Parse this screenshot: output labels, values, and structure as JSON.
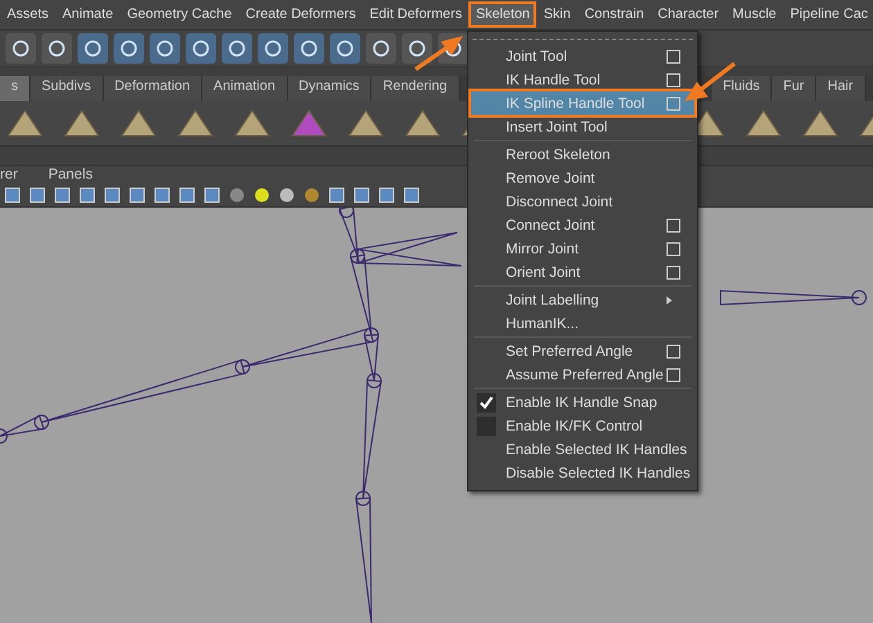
{
  "menubar": [
    {
      "label": "Assets",
      "selected": false
    },
    {
      "label": "Animate",
      "selected": false
    },
    {
      "label": "Geometry Cache",
      "selected": false
    },
    {
      "label": "Create Deformers",
      "selected": false
    },
    {
      "label": "Edit Deformers",
      "selected": false
    },
    {
      "label": "Skeleton",
      "selected": true
    },
    {
      "label": "Skin",
      "selected": false
    },
    {
      "label": "Constrain",
      "selected": false
    },
    {
      "label": "Character",
      "selected": false
    },
    {
      "label": "Muscle",
      "selected": false
    },
    {
      "label": "Pipeline Cac",
      "selected": false
    }
  ],
  "shelf_tabs": [
    {
      "label": "s",
      "selected": true
    },
    {
      "label": "Subdivs",
      "selected": false
    },
    {
      "label": "Deformation",
      "selected": false
    },
    {
      "label": "Animation",
      "selected": false
    },
    {
      "label": "Dynamics",
      "selected": false
    },
    {
      "label": "Rendering",
      "selected": false
    },
    {
      "label": "Fluids",
      "selected": false
    },
    {
      "label": "Fur",
      "selected": false
    },
    {
      "label": "Hair",
      "selected": false
    }
  ],
  "panel_menu": [
    "rer",
    "Panels"
  ],
  "skeleton_menu": {
    "sections": [
      [
        {
          "kind": "tool",
          "label": "Joint Tool",
          "option_box": true,
          "selected": false
        },
        {
          "kind": "tool",
          "label": "IK Handle Tool",
          "option_box": true,
          "selected": false
        },
        {
          "kind": "tool",
          "label": "IK Spline Handle Tool",
          "option_box": true,
          "selected": true
        },
        {
          "kind": "tool",
          "label": "Insert Joint Tool",
          "option_box": false,
          "selected": false
        }
      ],
      [
        {
          "kind": "tool",
          "label": "Reroot Skeleton",
          "option_box": false,
          "selected": false
        },
        {
          "kind": "tool",
          "label": "Remove Joint",
          "option_box": false,
          "selected": false
        },
        {
          "kind": "tool",
          "label": "Disconnect Joint",
          "option_box": false,
          "selected": false
        },
        {
          "kind": "tool",
          "label": "Connect Joint",
          "option_box": true,
          "selected": false
        },
        {
          "kind": "tool",
          "label": "Mirror Joint",
          "option_box": true,
          "selected": false
        },
        {
          "kind": "tool",
          "label": "Orient Joint",
          "option_box": true,
          "selected": false
        }
      ],
      [
        {
          "kind": "submenu",
          "label": "Joint Labelling",
          "selected": false
        },
        {
          "kind": "tool",
          "label": "HumanIK...",
          "option_box": false,
          "selected": false
        }
      ],
      [
        {
          "kind": "tool",
          "label": "Set Preferred Angle",
          "option_box": true,
          "selected": false
        },
        {
          "kind": "tool",
          "label": "Assume Preferred Angle",
          "option_box": true,
          "selected": false
        }
      ],
      [
        {
          "kind": "check",
          "label": "Enable IK Handle Snap",
          "checked": true,
          "selected": false
        },
        {
          "kind": "check",
          "label": "Enable IK/FK Control",
          "checked": false,
          "selected": false
        },
        {
          "kind": "tool",
          "label": "Enable Selected IK Handles",
          "option_box": false,
          "selected": false
        },
        {
          "kind": "tool",
          "label": "Disable Selected IK Handles",
          "option_box": false,
          "selected": false
        }
      ]
    ]
  }
}
